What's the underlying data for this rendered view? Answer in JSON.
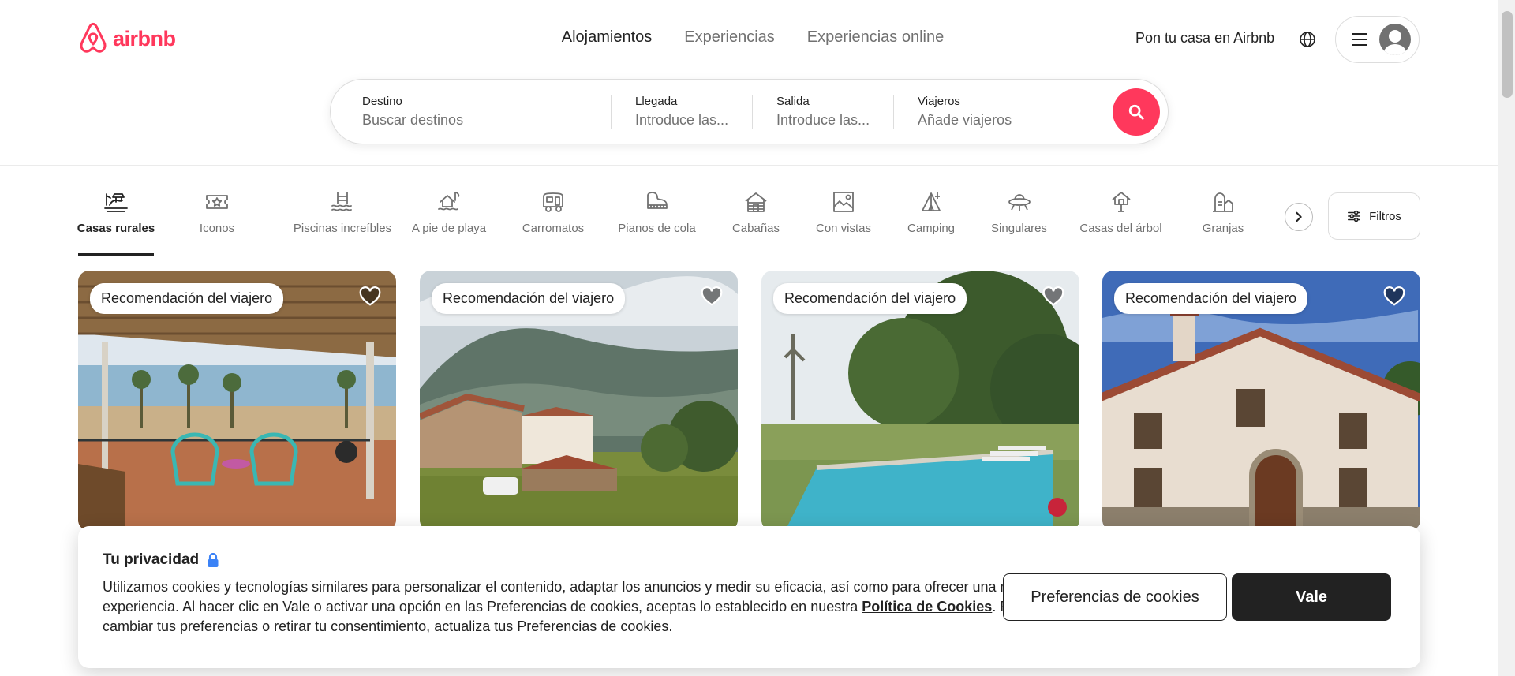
{
  "brand": {
    "name": "airbnb",
    "color": "#ff385c"
  },
  "nav": {
    "tabs": [
      {
        "label": "Alojamientos",
        "active": true
      },
      {
        "label": "Experiencias",
        "active": false
      },
      {
        "label": "Experiencias online",
        "active": false
      }
    ],
    "host_link": "Pon tu casa en Airbnb",
    "globe_icon": "globe-icon",
    "menu_icon": "hamburger-icon",
    "avatar_icon": "user-avatar-icon"
  },
  "search": {
    "destination": {
      "label": "Destino",
      "placeholder": "Buscar destinos"
    },
    "checkin": {
      "label": "Llegada",
      "placeholder": "Introduce las..."
    },
    "checkout": {
      "label": "Salida",
      "placeholder": "Introduce las..."
    },
    "guests": {
      "label": "Viajeros",
      "placeholder": "Añade viajeros"
    },
    "button_icon": "search-icon"
  },
  "categories": [
    {
      "label": "Casas rurales",
      "icon": "rural-house-icon",
      "active": true
    },
    {
      "label": "Iconos",
      "icon": "icons-ticket-icon",
      "active": false
    },
    {
      "label": "Piscinas increíbles",
      "icon": "pool-icon",
      "active": false
    },
    {
      "label": "A pie de playa",
      "icon": "beachfront-icon",
      "active": false
    },
    {
      "label": "Carromatos",
      "icon": "caravan-icon",
      "active": false
    },
    {
      "label": "Pianos de cola",
      "icon": "grand-piano-icon",
      "active": false
    },
    {
      "label": "Cabañas",
      "icon": "cabin-icon",
      "active": false
    },
    {
      "label": "Con vistas",
      "icon": "views-icon",
      "active": false
    },
    {
      "label": "Camping",
      "icon": "camping-icon",
      "active": false
    },
    {
      "label": "Singulares",
      "icon": "ufo-icon",
      "active": false
    },
    {
      "label": "Casas del árbol",
      "icon": "treehouse-icon",
      "active": false
    },
    {
      "label": "Granjas",
      "icon": "farm-icon",
      "active": false
    }
  ],
  "filters": {
    "label": "Filtros",
    "icon": "filter-sliders-icon"
  },
  "listings": [
    {
      "badge": "Recomendación del viajero",
      "image": "terrace-sea-view"
    },
    {
      "badge": "Recomendación del viajero",
      "image": "stone-farmhouse-mountains"
    },
    {
      "badge": "Recomendación del viajero",
      "image": "pool-garden-trees"
    },
    {
      "badge": "Recomendación del viajero",
      "image": "white-stone-villa"
    }
  ],
  "cookie": {
    "title": "Tu privacidad",
    "lock_icon": "lock-icon",
    "text_before": "Utilizamos cookies y tecnologías similares para personalizar el contenido, adaptar los anuncios y medir su eficacia, así como para ofrecer una mejor experiencia. Al hacer clic en Vale o activar una opción en las Preferencias de cookies, aceptas lo establecido en nuestra ",
    "link": "Política de Cookies",
    "text_after": ". Para cambiar tus preferencias o retirar tu consentimiento, actualiza tus Preferencias de cookies.",
    "preferences_button": "Preferencias de cookies",
    "accept_button": "Vale"
  }
}
